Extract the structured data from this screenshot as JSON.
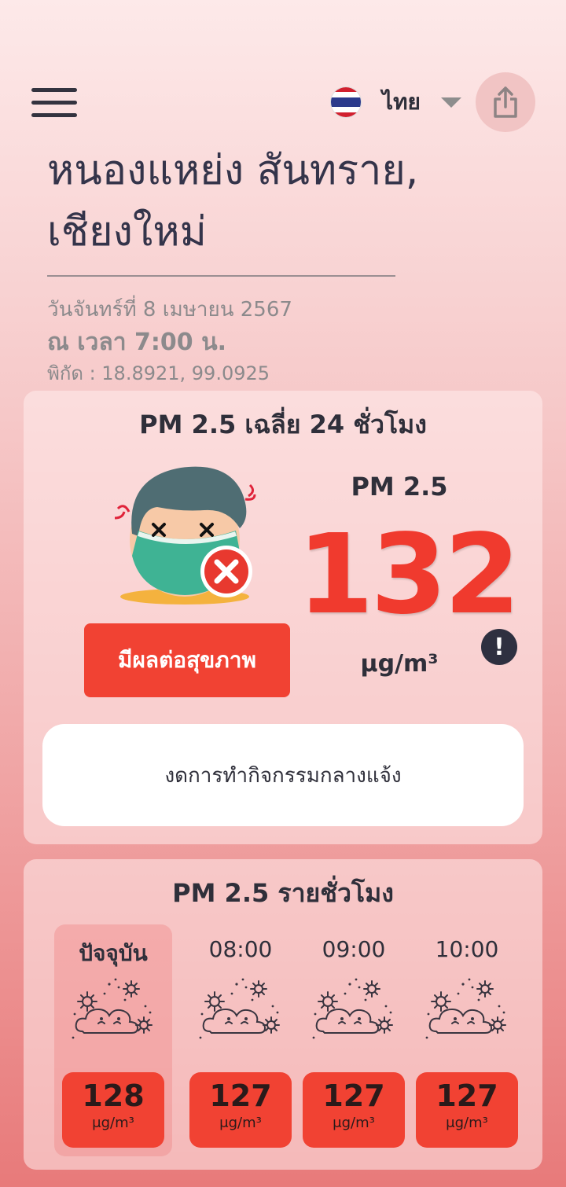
{
  "header": {
    "language_label": "ไทย",
    "flag_colors": [
      "#d1202f",
      "#ffffff",
      "#2b3a8c",
      "#ffffff",
      "#d1202f"
    ]
  },
  "location": {
    "line1": "หนองแหย่ง สันทราย,",
    "line2": "เชียงใหม่"
  },
  "datetime": {
    "date": "วันจันทร์ที่ 8 เมษายน 2567",
    "time": "ณ เวลา 7:00 น.",
    "coordinates": "พิกัด : 18.8921, 99.0925"
  },
  "daily": {
    "title": "PM 2.5 เฉลี่ย 24 ชั่วโมง",
    "status_label": "มีผลต่อสุขภาพ",
    "pm_label": "PM 2.5",
    "pm_value": "132",
    "unit": "μg/m³",
    "advice": "งดการทำกิจกรรมกลางแจ้ง",
    "info_icon": "!",
    "status_color": "#f14233"
  },
  "hourly": {
    "title": "PM 2.5 รายชั่วโมง",
    "items": [
      {
        "label": "ปัจจุบัน",
        "value": "128",
        "unit": "μg/m³"
      },
      {
        "label": "08:00",
        "value": "127",
        "unit": "μg/m³"
      },
      {
        "label": "09:00",
        "value": "127",
        "unit": "μg/m³"
      },
      {
        "label": "10:00",
        "value": "127",
        "unit": "μg/m³"
      }
    ]
  }
}
